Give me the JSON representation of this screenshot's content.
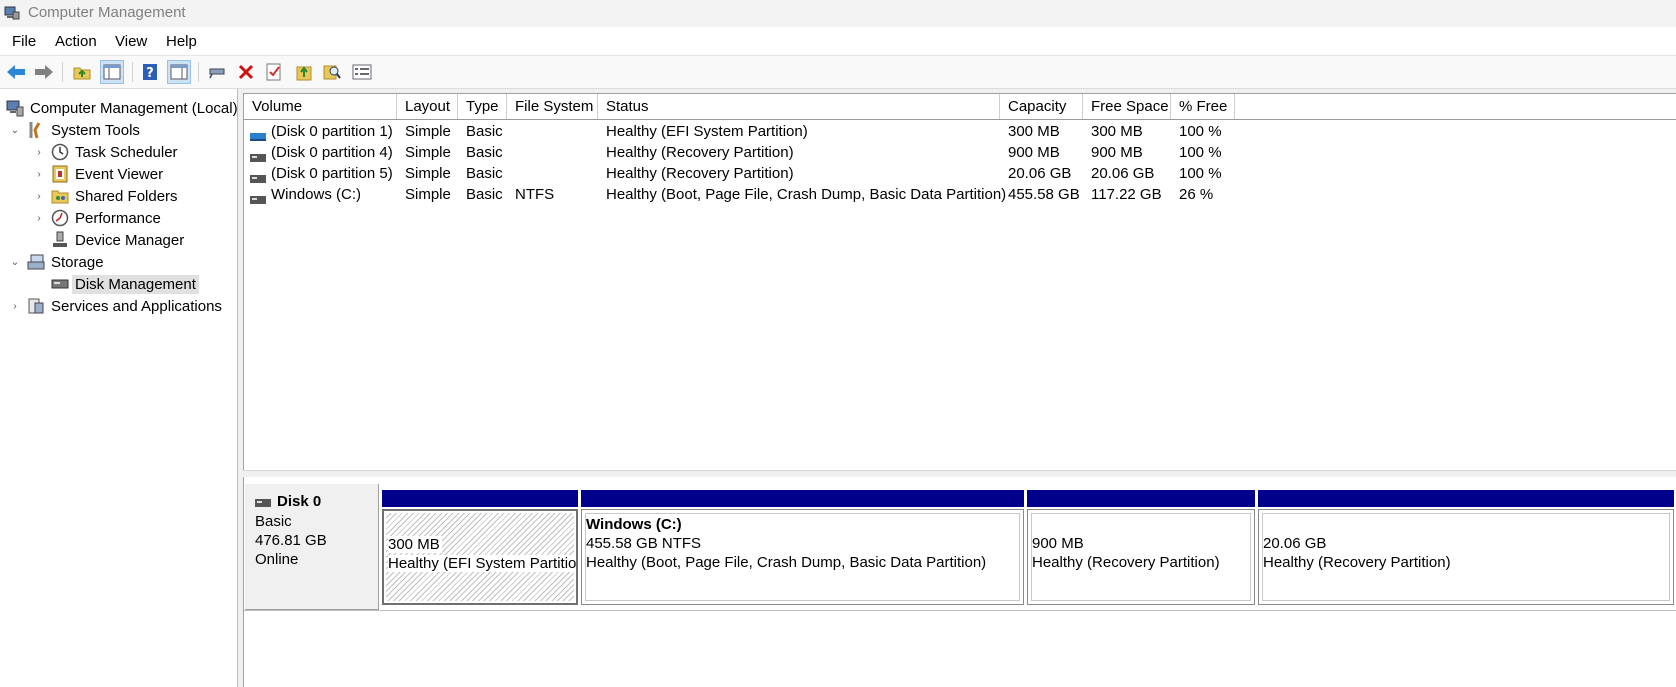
{
  "window": {
    "title": "Computer Management"
  },
  "menu": [
    "File",
    "Action",
    "View",
    "Help"
  ],
  "toolbar": {
    "icons": [
      "back-icon",
      "forward-icon",
      "up-folder-icon",
      "show-hide-tree-icon",
      "help-icon",
      "show-hide-action-pane-icon",
      "connect-icon",
      "delete-icon",
      "properties-icon",
      "open-icon",
      "search-icon",
      "settings-icon"
    ]
  },
  "tree": {
    "root": "Computer Management (Local)",
    "system_tools": "System Tools",
    "task_scheduler": "Task Scheduler",
    "event_viewer": "Event Viewer",
    "shared_folders": "Shared Folders",
    "performance": "Performance",
    "device_manager": "Device Manager",
    "storage": "Storage",
    "disk_management": "Disk Management",
    "services": "Services and Applications"
  },
  "volumes": {
    "columns": [
      "Volume",
      "Layout",
      "Type",
      "File System",
      "Status",
      "Capacity",
      "Free Space",
      "% Free"
    ],
    "rows": [
      [
        "(Disk 0 partition 1)",
        "Simple",
        "Basic",
        "",
        "Healthy (EFI System Partition)",
        "300 MB",
        "300 MB",
        "100 %"
      ],
      [
        "(Disk 0 partition 4)",
        "Simple",
        "Basic",
        "",
        "Healthy (Recovery Partition)",
        "900 MB",
        "900 MB",
        "100 %"
      ],
      [
        "(Disk 0 partition 5)",
        "Simple",
        "Basic",
        "",
        "Healthy (Recovery Partition)",
        "20.06 GB",
        "20.06 GB",
        "100 %"
      ],
      [
        "Windows (C:)",
        "Simple",
        "Basic",
        "NTFS",
        "Healthy (Boot, Page File, Crash Dump, Basic Data Partition)",
        "455.58 GB",
        "117.22 GB",
        "26 %"
      ]
    ]
  },
  "disk": {
    "name": "Disk 0",
    "type": "Basic",
    "size": "476.81 GB",
    "state": "Online",
    "partitions": [
      {
        "title": "",
        "size": "300 MB",
        "status": "Healthy (EFI System Partitior"
      },
      {
        "title": "Windows  (C:)",
        "size": "455.58 GB NTFS",
        "status": "Healthy (Boot, Page File, Crash Dump, Basic Data Partition)"
      },
      {
        "title": "",
        "size": "900 MB",
        "status": "Healthy (Recovery Partition)"
      },
      {
        "title": "",
        "size": "20.06 GB",
        "status": "Healthy (Recovery Partition)"
      }
    ]
  },
  "colors": {
    "partition_bar": "#00008b",
    "selection": "#e0e0e0"
  }
}
